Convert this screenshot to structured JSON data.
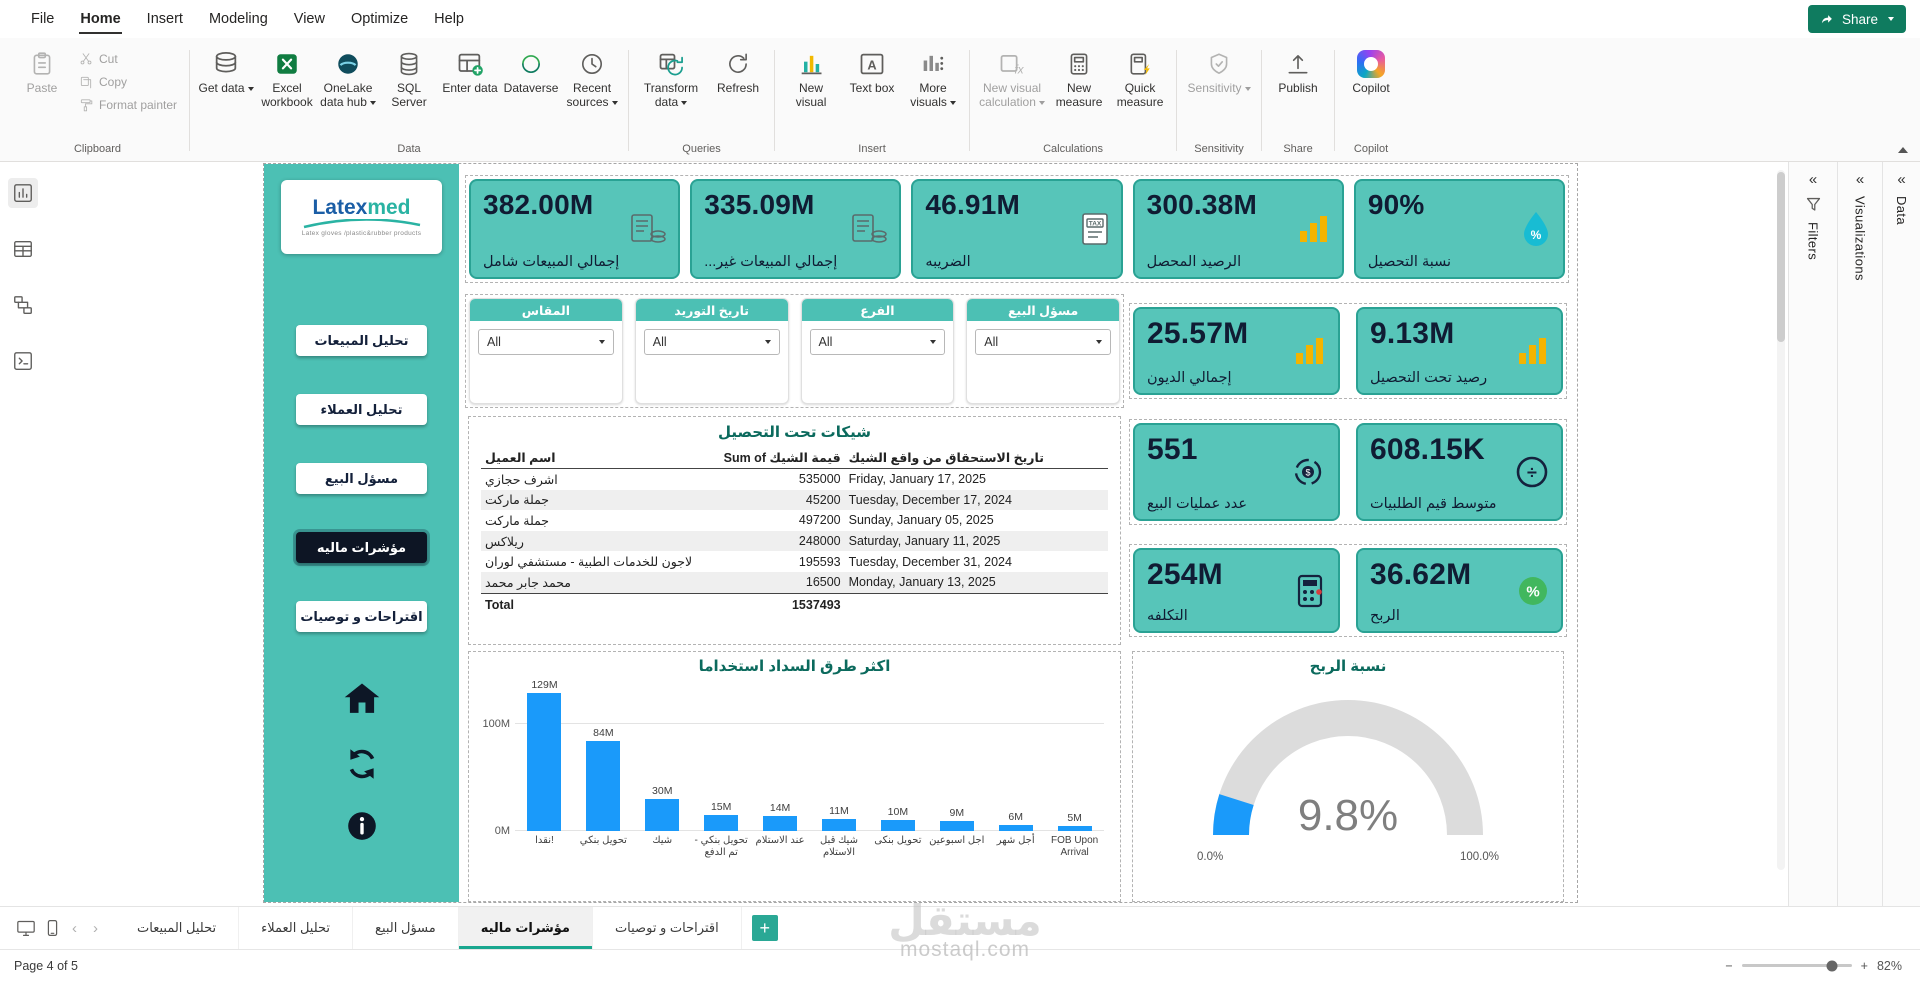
{
  "menubar": {
    "items": [
      "File",
      "Home",
      "Insert",
      "Modeling",
      "View",
      "Optimize",
      "Help"
    ],
    "share_label": "Share"
  },
  "ribbon": {
    "clipboard": {
      "label": "Clipboard",
      "paste": "Paste",
      "cut": "Cut",
      "copy": "Copy",
      "format_painter": "Format painter"
    },
    "data": {
      "label": "Data",
      "get_data": "Get data",
      "excel": "Excel workbook",
      "onelake": "OneLake data hub",
      "sql": "SQL Server",
      "enter_data": "Enter data",
      "dataverse": "Dataverse",
      "recent": "Recent sources"
    },
    "queries": {
      "label": "Queries",
      "transform": "Transform data",
      "refresh": "Refresh"
    },
    "insert": {
      "label": "Insert",
      "new_visual": "New visual",
      "text_box": "Text box",
      "more_visuals": "More visuals"
    },
    "calculations": {
      "label": "Calculations",
      "new_visual_calc": "New visual calculation",
      "new_measure": "New measure",
      "quick_measure": "Quick measure"
    },
    "sensitivity": {
      "label": "Sensitivity",
      "sensitivity": "Sensitivity"
    },
    "share": {
      "label": "Share",
      "publish": "Publish"
    },
    "copilot": {
      "label": "Copilot",
      "copilot": "Copilot"
    }
  },
  "icons": {
    "excel_letter": "X",
    "text_box_letter": "A",
    "tax_label": "TAX",
    "percent": "%",
    "divide": "÷",
    "dollar": "$",
    "info_letter": "i",
    "fx": "fx"
  },
  "sidebar": {
    "logo": {
      "brand_a": "Latex",
      "brand_b": "med",
      "tagline": "Latex gloves /plastic&rubber products"
    },
    "nav": [
      "تحليل المبيعات",
      "تحليل العملاء",
      "مسؤل البيع",
      "مؤشرات ماليه",
      "اقتراحات و توصيات"
    ]
  },
  "kpi_top": [
    {
      "value": "382.00M",
      "label": "إجمالي المبيعات شامل",
      "icon": "invoice-coins-icon"
    },
    {
      "value": "335.09M",
      "label": "إجمالي المبيعات غير...",
      "icon": "invoice-coins-icon"
    },
    {
      "value": "46.91M",
      "label": "الضريبه",
      "icon": "tax-document-icon"
    },
    {
      "value": "300.38M",
      "label": "الرصيد المحصل",
      "icon": "gold-bars-icon"
    },
    {
      "value": "90%",
      "label": "نسبة التحصيل",
      "icon": "droplet-percent-icon"
    }
  ],
  "filters": [
    {
      "title": "المقاس",
      "value": "All"
    },
    {
      "title": "تاريخ التوريد",
      "value": "All"
    },
    {
      "title": "الفرع",
      "value": "All"
    },
    {
      "title": "مسؤل البيع",
      "value": "All"
    }
  ],
  "kpi_right": [
    {
      "value": "25.57M",
      "label": "إجمالي الديون",
      "icon": "gold-bars-icon"
    },
    {
      "value": "9.13M",
      "label": "رصيد تحت التحصيل",
      "icon": "gold-bars-icon"
    },
    {
      "value": "551",
      "label": "عدد عمليات البيع",
      "icon": "sales-count-icon"
    },
    {
      "value": "608.15K",
      "label": "متوسط قيم الطلبيات",
      "icon": "avg-order-icon"
    },
    {
      "value": "254M",
      "label": "التكلفه",
      "icon": "calculator-icon"
    },
    {
      "value": "36.62M",
      "label": "الربح",
      "icon": "profit-percent-icon"
    }
  ],
  "table": {
    "title": "شيكات تحت التحصيل",
    "headers": [
      "اسم العميل",
      "Sum of قيمة الشيك",
      "تاريخ الاستحقاق من واقع الشيك"
    ],
    "rows": [
      [
        "اشرف حجازي",
        "535000",
        "Friday, January 17, 2025"
      ],
      [
        "جملة ماركت",
        "45200",
        "Tuesday, December 17, 2024"
      ],
      [
        "جملة ماركت",
        "497200",
        "Sunday, January 05, 2025"
      ],
      [
        "ريلاكس",
        "248000",
        "Saturday, January 11, 2025"
      ],
      [
        "لاجون للخدمات الطبية - مستشفي لوران",
        "195593",
        "Tuesday, December 31, 2024"
      ],
      [
        "محمد جابر محمد",
        "16500",
        "Monday, January 13, 2025"
      ]
    ],
    "total_label": "Total",
    "total_value": "1537493"
  },
  "chart_data": [
    {
      "type": "bar",
      "title": "اكثر طرق السداد استخداما",
      "categories": [
        "نقدا!",
        "تحويل بنكي",
        "شيك",
        "تحويل بنكي - تم الدفع",
        "عند الاستلام",
        "شيك قبل الاستلام",
        "تحويل بنكى",
        "اجل اسبوعين",
        "أجل شهر",
        "FOB Upon Arrival"
      ],
      "values": [
        129,
        84,
        30,
        15,
        14,
        11,
        10,
        9,
        6,
        5
      ],
      "data_labels": [
        "129M",
        "84M",
        "30M",
        "15M",
        "14M",
        "11M",
        "10M",
        "9M",
        "6M",
        "5M"
      ],
      "unit": "millions",
      "ylim": [
        0,
        140
      ],
      "yticks": [
        {
          "label": "0M",
          "value": 0
        },
        {
          "label": "100M",
          "value": 100
        }
      ],
      "bar_color": "#1a9afa",
      "legend": false,
      "grid": true
    },
    {
      "type": "gauge",
      "title": "نسبة الربح",
      "value": 9.8,
      "value_label": "9.8%",
      "min": 0,
      "max": 100,
      "min_label": "0.0%",
      "max_label": "100.0%",
      "fill_color": "#1a9afa",
      "track_color": "#dcdcdc"
    }
  ],
  "pages": {
    "tabs": [
      "تحليل المبيعات",
      "تحليل العملاء",
      "مسؤل البيع",
      "مؤشرات ماليه",
      "اقتراحات و توصيات"
    ],
    "active_index": 3
  },
  "panels": {
    "filters": "Filters",
    "visualizations": "Visualizations",
    "data": "Data"
  },
  "statusbar": {
    "page_indicator": "Page 4 of 5",
    "zoom_level": "82%"
  },
  "watermark": {
    "line1": "مستقل",
    "line2": "mostaql.com"
  },
  "colors": {
    "brand_teal": "#4cc0b4",
    "card_teal": "#57c5b9",
    "card_border": "#2aa294",
    "accent_blue": "#1a9afa",
    "navy": "#13203a",
    "title_green": "#0b6a5d",
    "gold": "#f4b400",
    "share_green": "#0f7b5f"
  }
}
